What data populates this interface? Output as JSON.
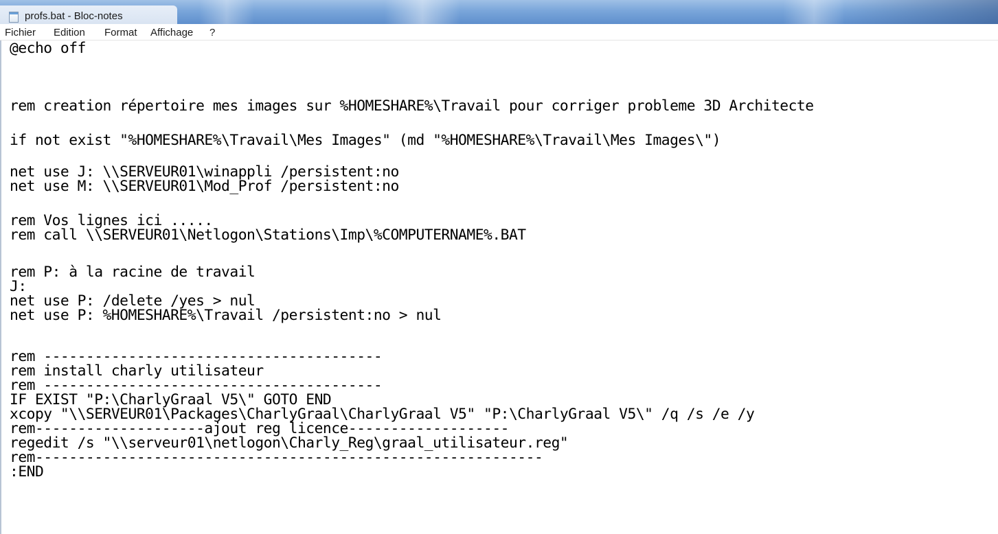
{
  "window": {
    "title": "profs.bat - Bloc-notes",
    "icon": "notepad-icon"
  },
  "menu": {
    "items": [
      "Fichier",
      "Edition",
      "Format",
      "Affichage",
      "?"
    ]
  },
  "editor": {
    "lines": [
      "@echo off",
      "",
      "rem creation répertoire mes images sur %HOMESHARE%\\Travail pour corriger probleme 3D Architecte",
      "",
      "if not exist \"%HOMESHARE%\\Travail\\Mes Images\" (md \"%HOMESHARE%\\Travail\\Mes Images\\\")",
      "",
      "net use J: \\\\SERVEUR01\\winappli /persistent:no",
      "net use M: \\\\SERVEUR01\\Mod_Prof /persistent:no",
      "",
      "rem Vos lignes ici .....",
      "rem call \\\\SERVEUR01\\Netlogon\\Stations\\Imp\\%COMPUTERNAME%.BAT",
      "",
      "rem P: à la racine de travail",
      "J:",
      "net use P: /delete /yes > nul",
      "net use P: %HOMESHARE%\\Travail /persistent:no > nul",
      "",
      "rem ----------------------------------------",
      "rem install charly utilisateur",
      "rem ----------------------------------------",
      "IF EXIST \"P:\\CharlyGraal V5\\\" GOTO END",
      "xcopy \"\\\\SERVEUR01\\Packages\\CharlyGraal\\CharlyGraal V5\" \"P:\\CharlyGraal V5\\\" /q /s /e /y",
      "rem--------------------ajout reg licence-------------------",
      "regedit /s \"\\\\serveur01\\netlogon\\Charly_Reg\\graal_utilisateur.reg\"",
      "rem------------------------------------------------------------",
      ":END"
    ]
  }
}
